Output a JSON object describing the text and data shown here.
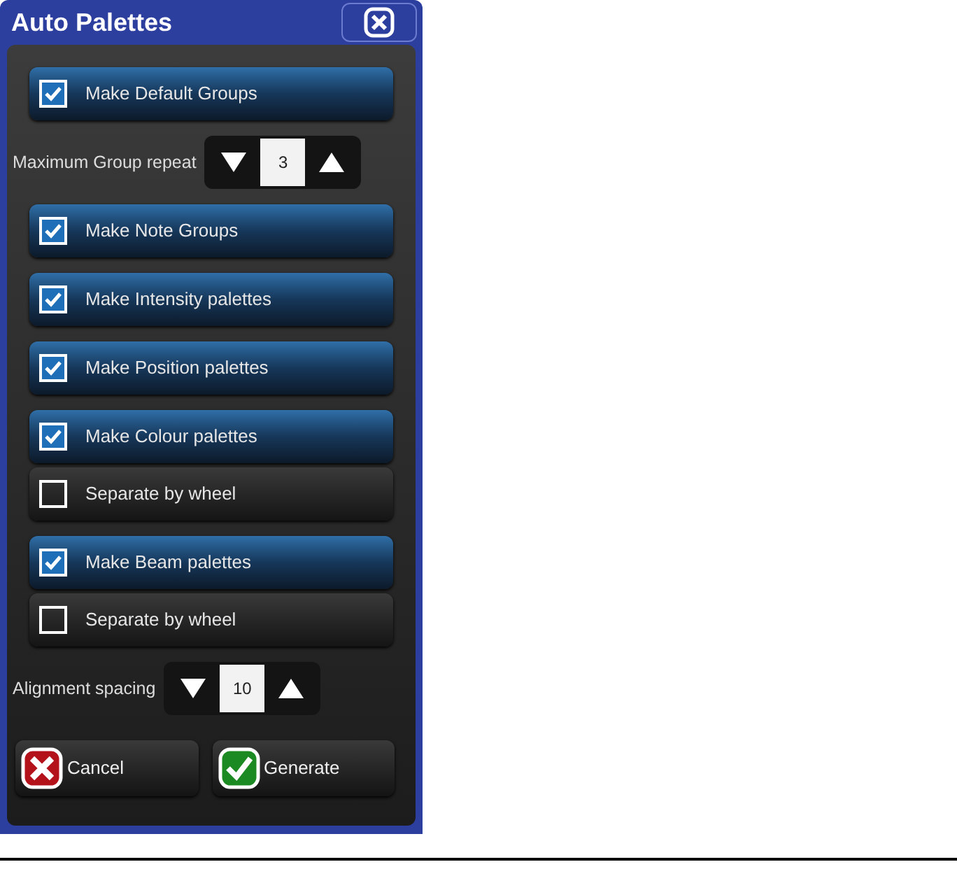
{
  "window": {
    "title": "Auto Palettes"
  },
  "rows": [
    {
      "kind": "checkbox",
      "label": "Make Default Groups",
      "checked": true
    },
    {
      "kind": "stepper",
      "label": "Maximum Group repeat",
      "value": "3"
    },
    {
      "kind": "checkbox",
      "label": "Make Note Groups",
      "checked": true
    },
    {
      "kind": "checkbox",
      "label": "Make Intensity palettes",
      "checked": true
    },
    {
      "kind": "checkbox",
      "label": "Make Position palettes",
      "checked": true
    },
    {
      "kind": "checkbox",
      "label": "Make Colour palettes",
      "checked": true
    },
    {
      "kind": "suboption",
      "label": "Separate by wheel",
      "checked": false
    },
    {
      "kind": "checkbox",
      "label": "Make Beam palettes",
      "checked": true
    },
    {
      "kind": "suboption",
      "label": "Separate by wheel",
      "checked": false
    },
    {
      "kind": "stepper",
      "label": "Alignment spacing",
      "value": "10"
    }
  ],
  "buttons": [
    {
      "kind": "cancel",
      "label": "Cancel"
    },
    {
      "kind": "confirm",
      "label": "Generate"
    }
  ]
}
